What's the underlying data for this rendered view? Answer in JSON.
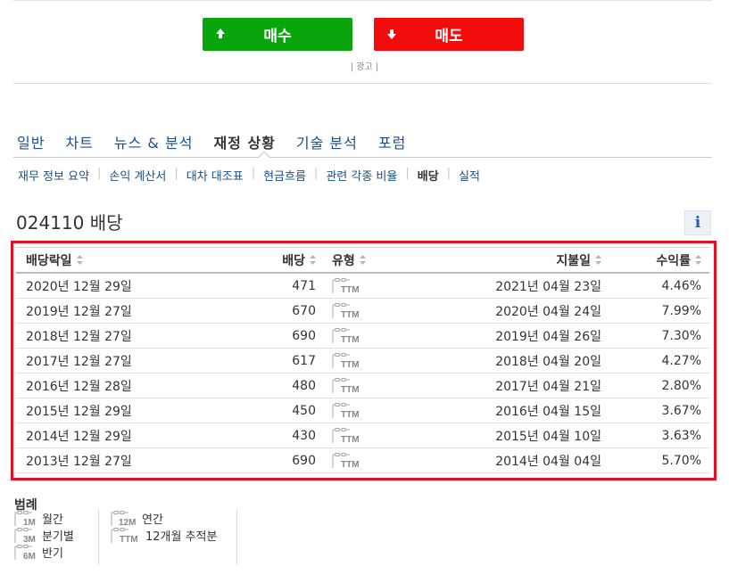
{
  "trade": {
    "buy_label": "매수",
    "sell_label": "매도",
    "buy_color": "#0aa50c",
    "sell_color": "#f20c0c"
  },
  "ad_label": "| 광고 |",
  "main_tabs": [
    "일반",
    "차트",
    "뉴스 & 분석",
    "재정 상황",
    "기술 분석",
    "포럼"
  ],
  "sub_tabs": [
    "재무 정보 요약",
    "손익 계산서",
    "대차 대조표",
    "현금흐름",
    "관련 각종 비율",
    "배당",
    "실적"
  ],
  "page_title": "024110 배당",
  "info_icon_label": "i",
  "table": {
    "headers": {
      "ex_date": "배당락일",
      "amount": "배당",
      "type": "유형",
      "pay_date": "지불일",
      "yield": "수익률"
    },
    "rows": [
      {
        "ex_date": "2020년 12월 29일",
        "amount": "471",
        "type": "TTM",
        "pay_date": "2021년 04월 23일",
        "yield": "4.46%"
      },
      {
        "ex_date": "2019년 12월 27일",
        "amount": "670",
        "type": "TTM",
        "pay_date": "2020년 04월 24일",
        "yield": "7.99%"
      },
      {
        "ex_date": "2018년 12월 27일",
        "amount": "690",
        "type": "TTM",
        "pay_date": "2019년 04월 26일",
        "yield": "7.30%"
      },
      {
        "ex_date": "2017년 12월 27일",
        "amount": "617",
        "type": "TTM",
        "pay_date": "2018년 04월 20일",
        "yield": "4.27%"
      },
      {
        "ex_date": "2016년 12월 28일",
        "amount": "480",
        "type": "TTM",
        "pay_date": "2017년 04월 21일",
        "yield": "2.80%"
      },
      {
        "ex_date": "2015년 12월 29일",
        "amount": "450",
        "type": "TTM",
        "pay_date": "2016년 04월 15일",
        "yield": "3.67%"
      },
      {
        "ex_date": "2014년 12월 29일",
        "amount": "430",
        "type": "TTM",
        "pay_date": "2015년 04월 10일",
        "yield": "3.63%"
      },
      {
        "ex_date": "2013년 12월 27일",
        "amount": "690",
        "type": "TTM",
        "pay_date": "2014년 04월 04일",
        "yield": "5.70%"
      }
    ]
  },
  "legend": {
    "title": "범례",
    "items": [
      {
        "code": "1M",
        "label": "월간"
      },
      {
        "code": "3M",
        "label": "분기별"
      },
      {
        "code": "6M",
        "label": "반기"
      },
      {
        "code": "12M",
        "label": "연간"
      },
      {
        "code": "TTM",
        "label": "12개월 추적분"
      }
    ]
  }
}
